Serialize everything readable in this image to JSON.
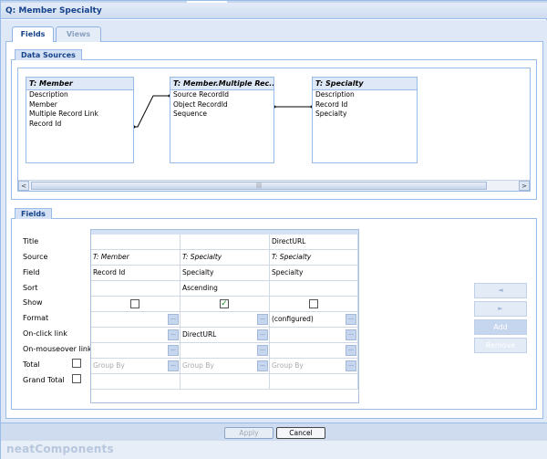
{
  "window": {
    "title": "Q: Member Specialty"
  },
  "tabs": [
    {
      "label": "Fields",
      "active": true
    },
    {
      "label": "Views",
      "active": false
    }
  ],
  "data_sources": {
    "section_label": "Data Sources",
    "tables": [
      {
        "name": "T: Member",
        "fields": [
          "Description",
          "Member",
          "Multiple Record Link",
          "Record Id"
        ]
      },
      {
        "name": "T: Member.Multiple Rec...",
        "fields": [
          "Source RecordId",
          "Object RecordId",
          "Sequence"
        ]
      },
      {
        "name": "T: Specialty",
        "fields": [
          "Description",
          "Record Id",
          "Specialty"
        ]
      }
    ],
    "scrollbar": {
      "left_arrow": "<",
      "thumb_grip": "|||",
      "right_arrow": ">"
    }
  },
  "fields": {
    "section_label": "Fields",
    "row_labels": [
      "Title",
      "Source",
      "Field",
      "Sort",
      "Show",
      "Format",
      "On-click link",
      "On-mouseover link",
      "Total",
      "Grand Total"
    ],
    "columns": [
      {
        "title": "",
        "source": "T: Member",
        "field": "Record Id",
        "sort": "",
        "show": false,
        "format": "",
        "onclick": "",
        "onmouseover": "",
        "total": "Group By"
      },
      {
        "title": "",
        "source": "T: Specialty",
        "field": "Specialty",
        "sort": "Ascending",
        "show": true,
        "format": "",
        "onclick": "DirectURL",
        "onmouseover": "",
        "total": "Group By"
      },
      {
        "title": "DirectURL",
        "source": "T: Specialty",
        "field": "Specialty",
        "sort": "",
        "show": false,
        "format": "(configured)",
        "onclick": "",
        "onmouseover": "",
        "total": "Group By"
      }
    ],
    "ellipsis": "...",
    "total_checked": false,
    "grand_total_checked": false
  },
  "side_buttons": {
    "move_left": "◄",
    "move_right": "►",
    "add": "Add",
    "remove": "Remove"
  },
  "footer_buttons": {
    "apply": "Apply",
    "cancel": "Cancel"
  },
  "brand": "neatComponents",
  "check_mark": "✓"
}
